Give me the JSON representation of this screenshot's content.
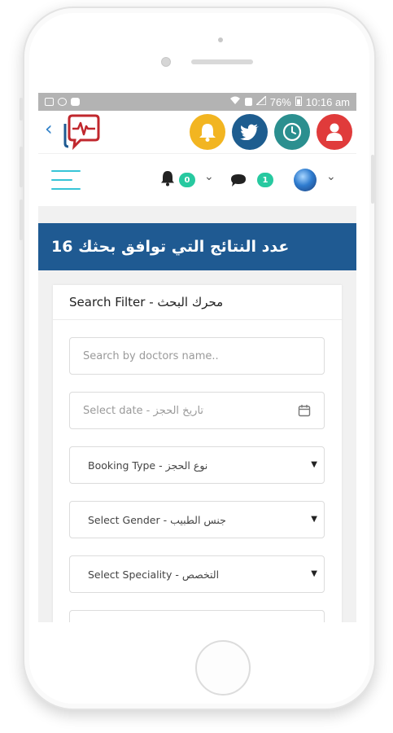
{
  "statusbar": {
    "battery": "76%",
    "time": "10:16 am"
  },
  "header": {
    "back_icon": "chevron-left-icon",
    "logo_icon": "heartbeat-chat-logo-icon",
    "buttons": [
      {
        "name": "notifications-button",
        "icon": "bell-icon",
        "color": "#f2b521"
      },
      {
        "name": "twitter-button",
        "icon": "bird-icon",
        "color": "#1e5d8f"
      },
      {
        "name": "appointments-button",
        "icon": "clock-icon",
        "color": "#2b8f8f"
      },
      {
        "name": "profile-button",
        "icon": "user-icon",
        "color": "#e03b3b"
      }
    ]
  },
  "navbar": {
    "notification_count": "0",
    "message_count": "1"
  },
  "results": {
    "title": "عدد النتائج التي توافق بحثك 16"
  },
  "filter": {
    "heading": "Search Filter - محرك البحث",
    "search_placeholder": "Search by doctors name..",
    "date_placeholder": "Select date - تاريخ الحجز",
    "booking_type": "Booking Type - نوع الحجز",
    "gender": "Select Gender - جنس الطبيب",
    "speciality": "Select Speciality - التخصص"
  },
  "colors": {
    "accent_blue": "#1f5a92",
    "badge_green": "#27c9a0",
    "menu_cyan": "#37c4d7"
  }
}
